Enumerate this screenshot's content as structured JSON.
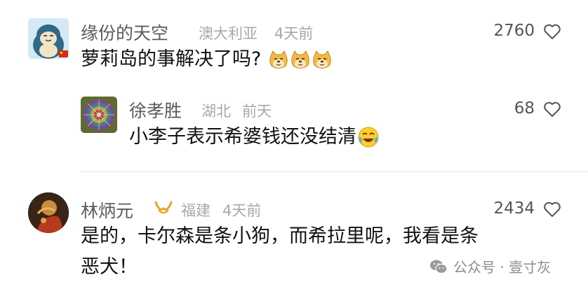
{
  "comments": [
    {
      "name": "缘份的天空",
      "location": "澳大利亚",
      "time": "4天前",
      "text": "萝莉岛的事解决了吗?",
      "likes": "2760",
      "reply": {
        "name": "徐孝胜",
        "location": "湖北",
        "time": "前天",
        "text": "小李子表示希婆钱还没结清",
        "likes": "68"
      }
    },
    {
      "name": "林炳元",
      "location": "福建",
      "time": "4天前",
      "text_line1": "是的，卡尔森是条小狗，而希拉里呢，我看是条",
      "text_line2": "恶犬！",
      "likes": "2434"
    }
  ],
  "watermark": {
    "text": "公众号 · 壹寸灰"
  },
  "colors": {
    "name": "#5b5b5b",
    "meta": "#a8a8a8",
    "text": "#111111",
    "divider": "#e6e6e6"
  }
}
